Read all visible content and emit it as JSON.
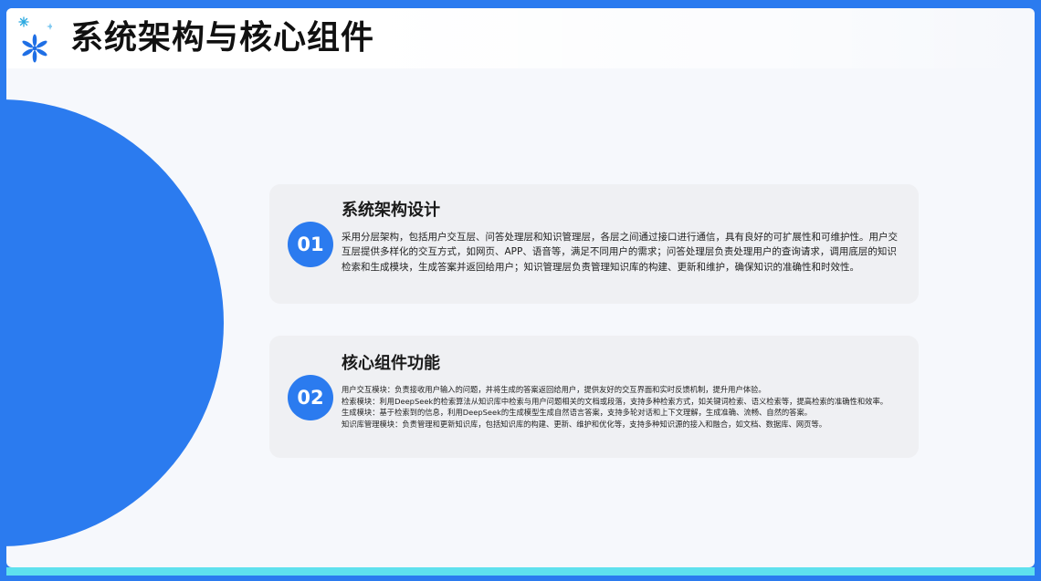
{
  "slide": {
    "title": "系统架构与核心组件",
    "logo_icon": "sparkle-icon",
    "colors": {
      "primary": "#2b7bef",
      "accent_band": "#5fe1ee",
      "card_bg": "#eff0f3"
    }
  },
  "sections": [
    {
      "number": "01",
      "title": "系统架构设计",
      "paragraphs": [
        "采用分层架构，包括用户交互层、问答处理层和知识管理层，各层之间通过接口进行通信，具有良好的可扩展性和可维护性。用户交互层提供多样化的交互方式，如网页、APP、语音等，满足不同用户的需求；问答处理层负责处理用户的查询请求，调用底层的知识检索和生成模块，生成答案并返回给用户；知识管理层负责管理知识库的构建、更新和维护，确保知识的准确性和时效性。"
      ]
    },
    {
      "number": "02",
      "title": "核心组件功能",
      "paragraphs": [
        "用户交互模块：负责接收用户输入的问题，并将生成的答案返回给用户，提供友好的交互界面和实时反馈机制，提升用户体验。",
        "检索模块：利用DeepSeek的检索算法从知识库中检索与用户问题相关的文档或段落，支持多种检索方式，如关键词检索、语义检索等，提高检索的准确性和效率。",
        "生成模块：基于检索到的信息，利用DeepSeek的生成模型生成自然语言答案，支持多轮对话和上下文理解，生成准确、流畅、自然的答案。",
        "知识库管理模块：负责管理和更新知识库，包括知识库的构建、更新、维护和优化等，支持多种知识源的接入和融合，如文档、数据库、网页等。"
      ]
    }
  ]
}
